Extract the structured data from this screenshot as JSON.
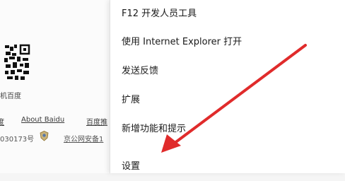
{
  "background_page": {
    "caption": "机百度",
    "links": [
      "度",
      "About  Baidu",
      "百度推"
    ],
    "license": [
      "030173号",
      "京公网安备1"
    ]
  },
  "menu": {
    "items": [
      {
        "label": "F12 开发人员工具"
      },
      {
        "label": "使用 Internet Explorer 打开"
      },
      {
        "label": "发送反馈"
      },
      {
        "label": "扩展"
      },
      {
        "label": "新增功能和提示"
      },
      {
        "label": "设置"
      }
    ]
  },
  "annotation": {
    "arrow_color": "#e02b2b"
  }
}
